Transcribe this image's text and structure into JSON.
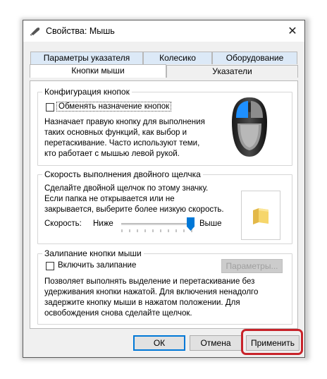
{
  "window": {
    "title": "Свойства: Мышь",
    "close_glyph": "✕"
  },
  "tabs": {
    "row1": [
      "Параметры указателя",
      "Колесико",
      "Оборудование"
    ],
    "row2": [
      "Кнопки мыши",
      "Указатели"
    ],
    "active": "Кнопки мыши"
  },
  "button_config": {
    "legend": "Конфигурация кнопок",
    "swap_label": "Обменять назначение кнопок",
    "swap_checked": false,
    "description": [
      "Назначает правую кнопку для выполнения",
      "таких основных функций, как выбор и",
      "перетаскивание. Часто используют теми,",
      "кто работает с мышью левой рукой."
    ]
  },
  "double_click": {
    "legend": "Скорость выполнения двойного щелчка",
    "description": [
      "Сделайте двойной щелчок по этому значку.",
      "Если папка не открывается или не",
      "закрывается, выберите более низкую скорость."
    ],
    "speed_label": "Скорость:",
    "low_label": "Ниже",
    "high_label": "Выше",
    "speed_fraction": 0.95
  },
  "click_lock": {
    "legend": "Залипание кнопки мыши",
    "enable_label": "Включить залипание",
    "enabled": false,
    "settings_button": "Параметры...",
    "description": [
      "Позволяет выполнять выделение и перетаскивание без",
      "удерживания кнопки нажатой. Для включения ненадолго",
      "задержите кнопку мыши в нажатом положении. Для",
      "освобождения снова сделайте щелчок."
    ]
  },
  "footer": {
    "ok": "ОК",
    "cancel": "Отмена",
    "apply": "Применить"
  },
  "colors": {
    "accent": "#0078d7",
    "highlight": "#c8232a",
    "mouse_button": "#1e90ff",
    "folder": "#f6d66b"
  }
}
